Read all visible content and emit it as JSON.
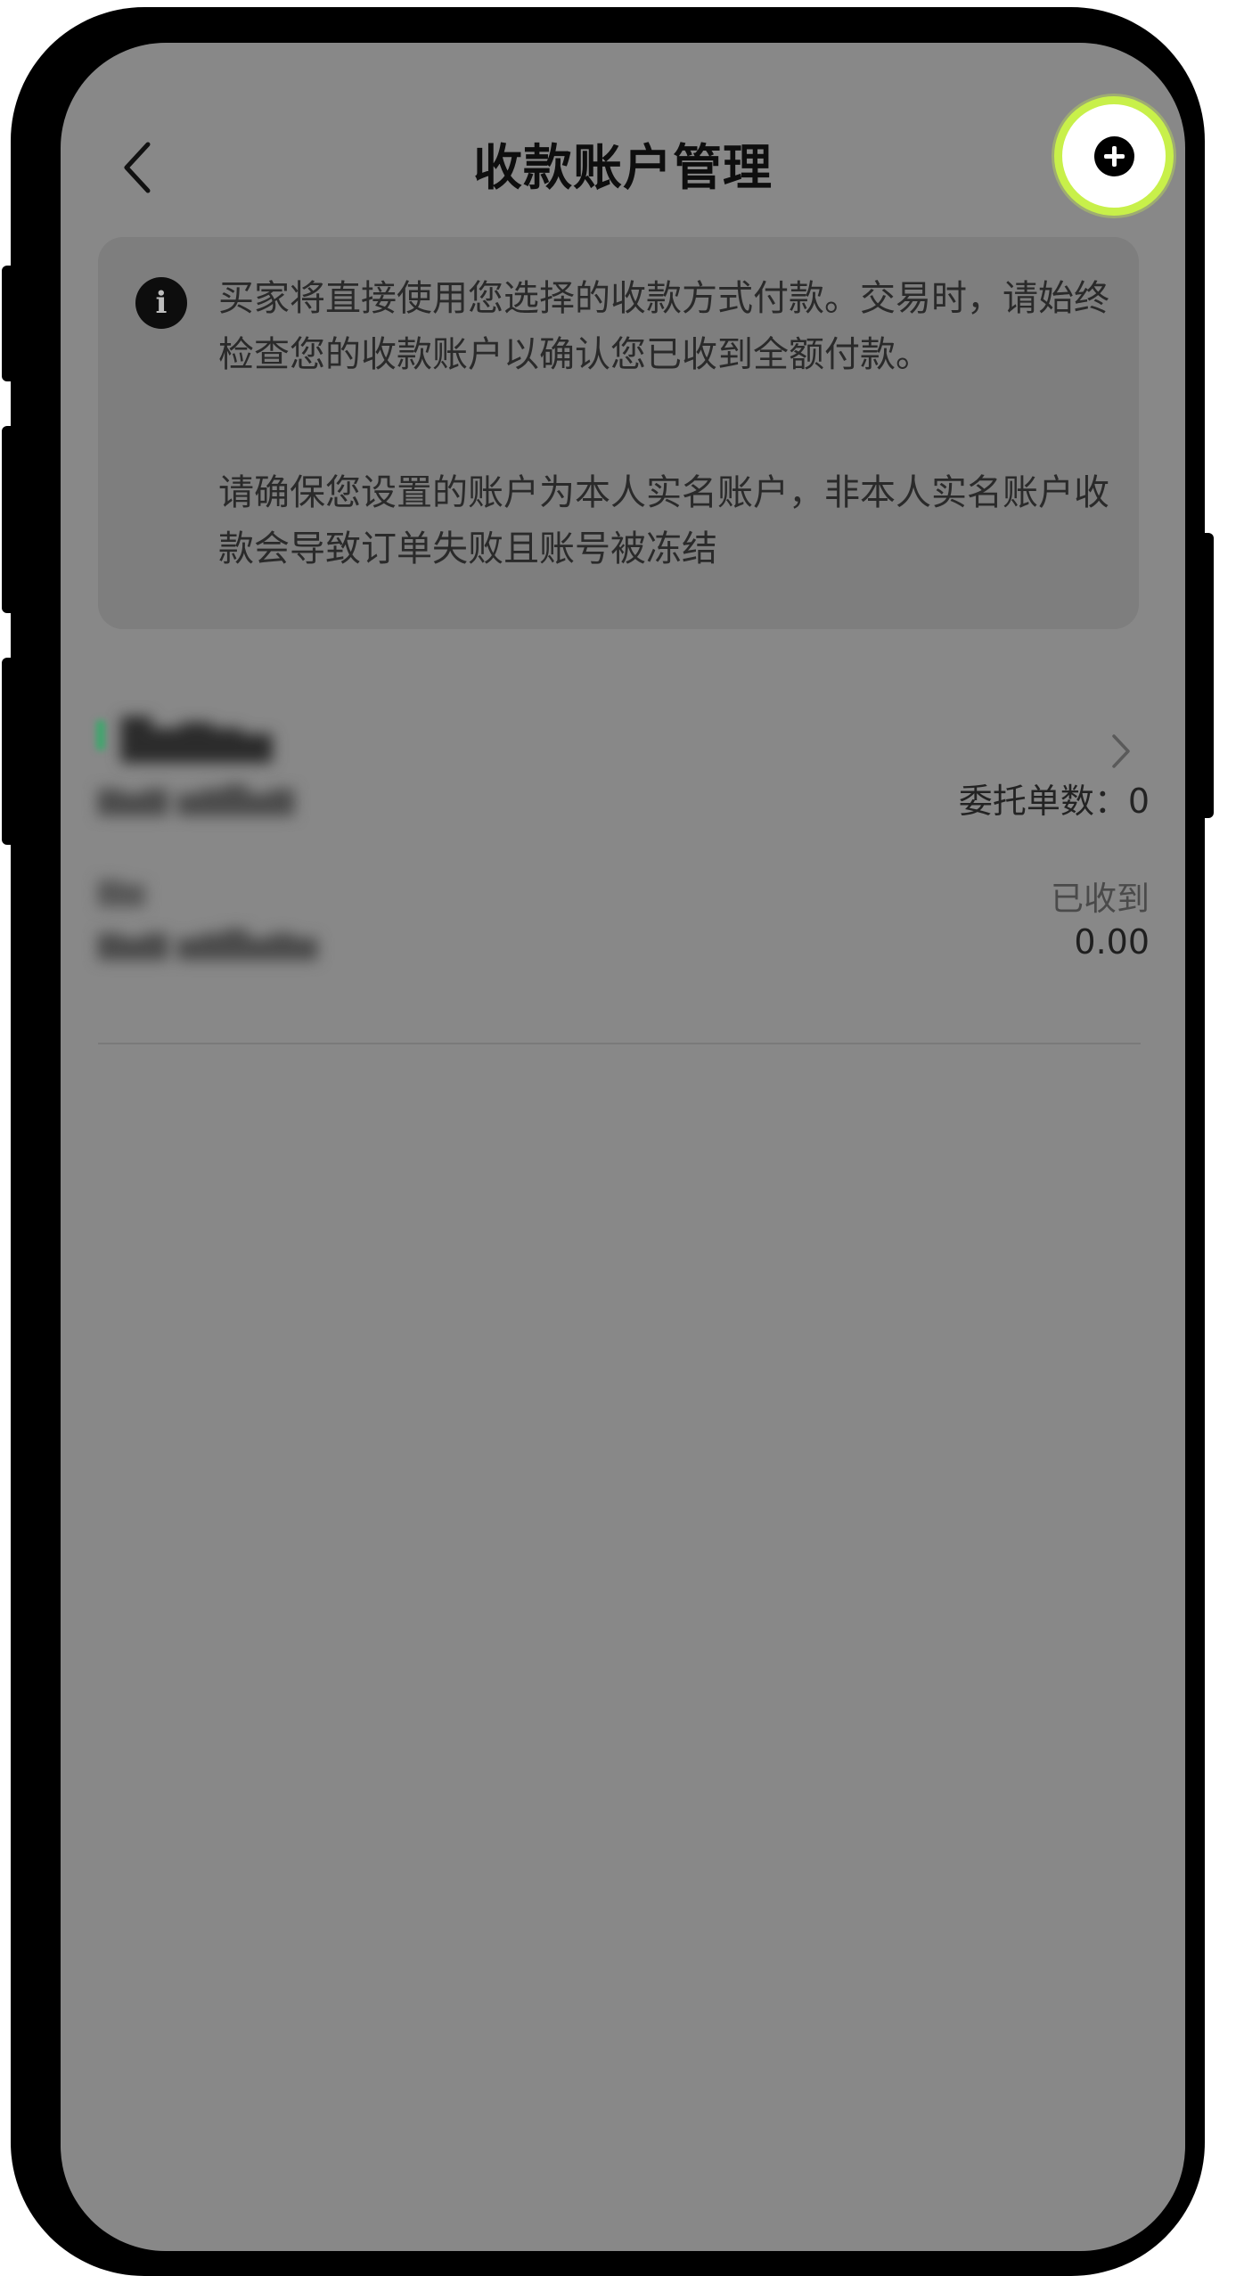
{
  "header": {
    "title": "收款账户管理",
    "back_icon": "chevron-left-icon",
    "add_icon": "plus-circle-icon"
  },
  "notice": {
    "icon": "info-icon",
    "icon_glyph": "i",
    "paragraph1": "买家将直接使用您选择的收款方式付款。交易时，请始终检查您的收款账户以确认您已收到全额付款。",
    "paragraph2": "请确保您设置的账户为本人实名账户，非本人实名账户收款会导致订单失败且账号被冻结"
  },
  "account": {
    "entrust_count": "委托单数：0",
    "received_label": "已收到",
    "received_value": "0.00"
  },
  "colors": {
    "highlight_ring": "#c8f04a",
    "overlay": "#888888",
    "mark_green": "#3aa86b"
  }
}
